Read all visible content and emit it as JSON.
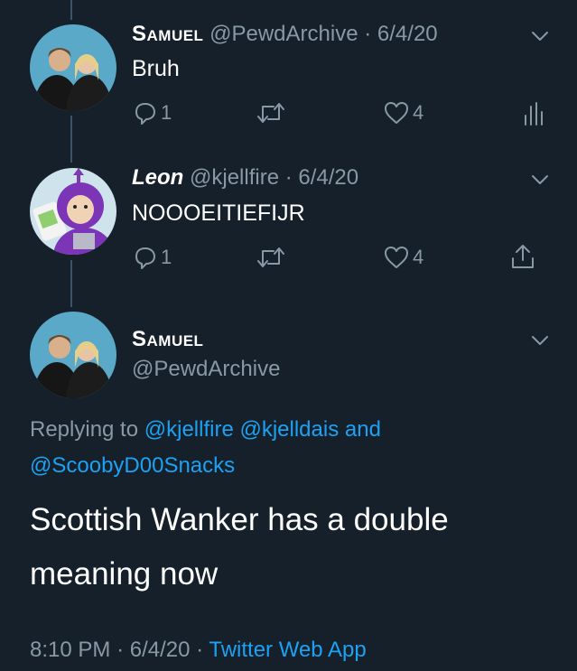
{
  "tweets": [
    {
      "name": "Samuel",
      "handle": "@PewdArchive",
      "sep": "·",
      "date": "6/4/20",
      "text": "Bruh",
      "replies": "1",
      "likes": "4",
      "share_icon": "analytics-icon"
    },
    {
      "name": "Leon",
      "handle": "@kjellfire",
      "sep": "·",
      "date": "6/4/20",
      "text": "NOOOEITIEFIJR",
      "replies": "1",
      "likes": "4",
      "share_icon": "share-icon"
    }
  ],
  "main": {
    "name": "Samuel",
    "handle": "@PewdArchive",
    "replying_prefix": "Replying to",
    "replying_mentions": [
      "@kjellfire",
      "@kjelldais"
    ],
    "replying_and": "and",
    "replying_last": "@ScoobyD00Snacks",
    "text_line1": "Scottish Wanker has a double",
    "text_line2": "meaning now",
    "time": "8:10 PM",
    "sep": "·",
    "date": "6/4/20",
    "source": "Twitter Web App"
  },
  "colors": {
    "background": "#15202b",
    "muted": "#8899a6",
    "link": "#1da1f2",
    "thread_line": "#3d5466"
  }
}
